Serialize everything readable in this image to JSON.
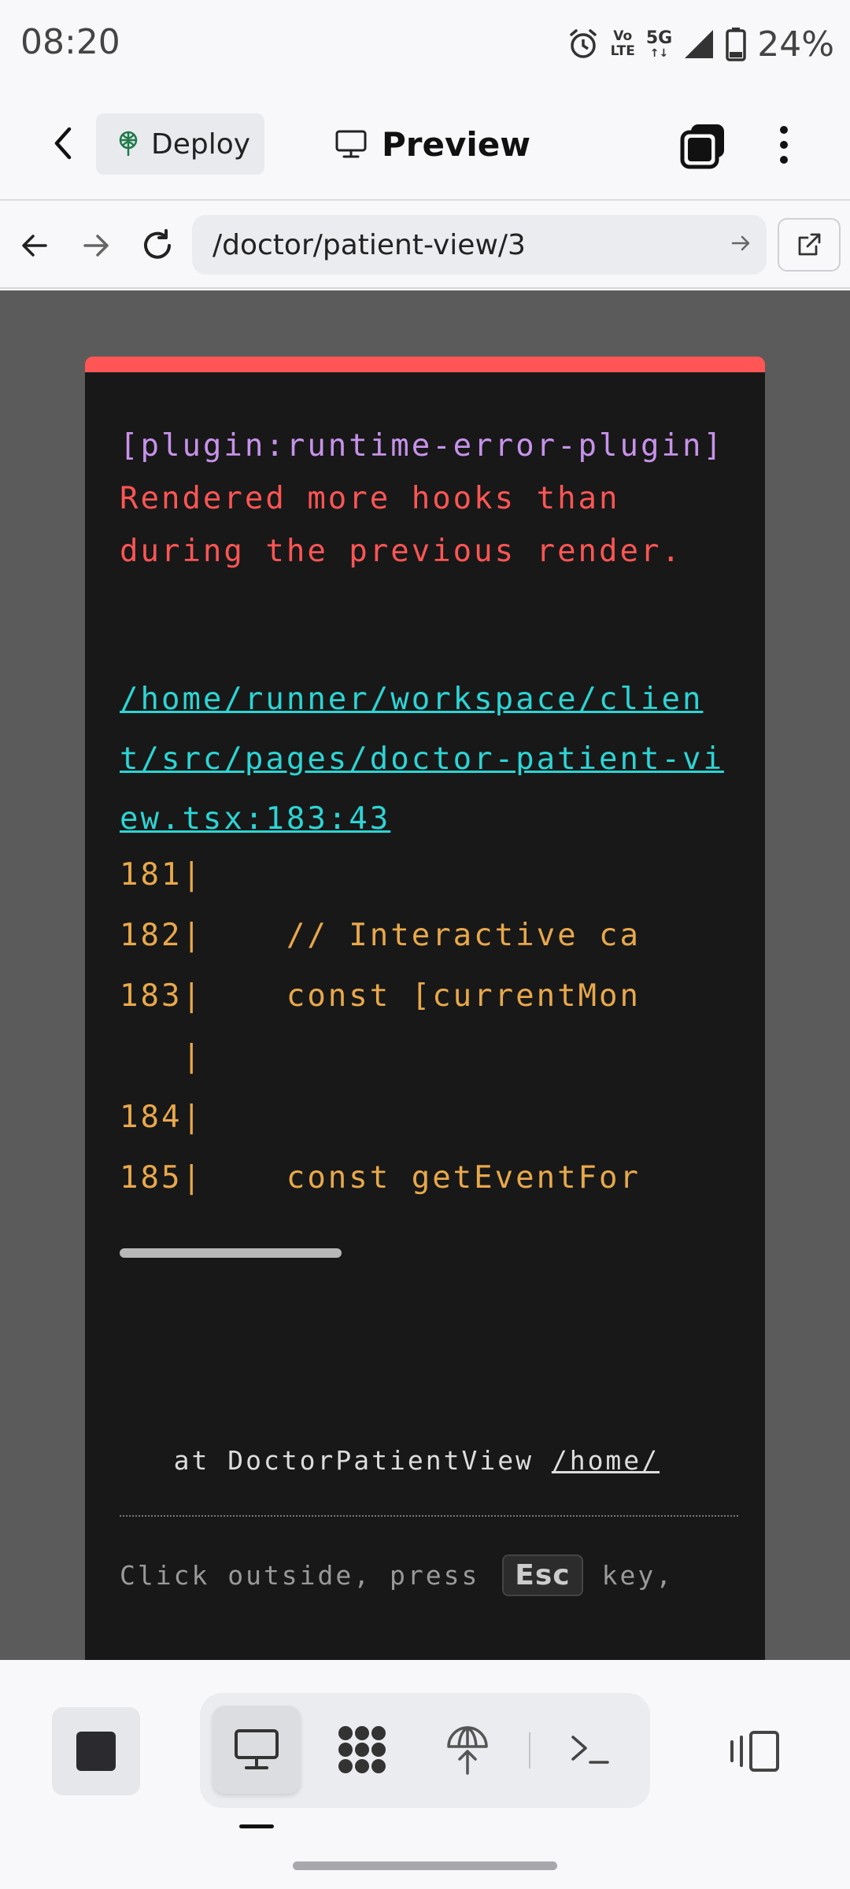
{
  "status_bar": {
    "time": "08:20",
    "net_vo": "Vo",
    "net_lte": "LTE",
    "net_5g": "5G",
    "battery": "24%",
    "icons": [
      "alarm-icon",
      "volte-icon",
      "5g-icon",
      "signal-icon",
      "battery-icon"
    ]
  },
  "header": {
    "deploy_label": "Deploy",
    "preview_label": "Preview"
  },
  "url_bar": {
    "url": "/doctor/patient-view/3"
  },
  "error": {
    "plugin": "[plugin:runtime-error-plugin]",
    "message": "Rendered more hooks than during the previous render.",
    "file": "/home/runner/workspace/client/src/pages/doctor-patient-view.tsx:183:43",
    "code_lines": [
      "181|",
      "182|    // Interactive ca",
      "183|    const [currentMon",
      "   |",
      "184|",
      "185|    const getEventFor"
    ],
    "stack_prefix": "   at DoctorPatientView ",
    "stack_link": "/home/",
    "tip_prefix": "Click outside, press ",
    "tip_key": "Esc",
    "tip_suffix": "key,"
  },
  "colors": {
    "error_accent": "#ff5555",
    "plugin_text": "#c792ea",
    "file_link": "#2dd4d4",
    "code_text": "#e8a84b",
    "card_bg": "#181818",
    "viewport_bg": "#5b5b5b"
  }
}
